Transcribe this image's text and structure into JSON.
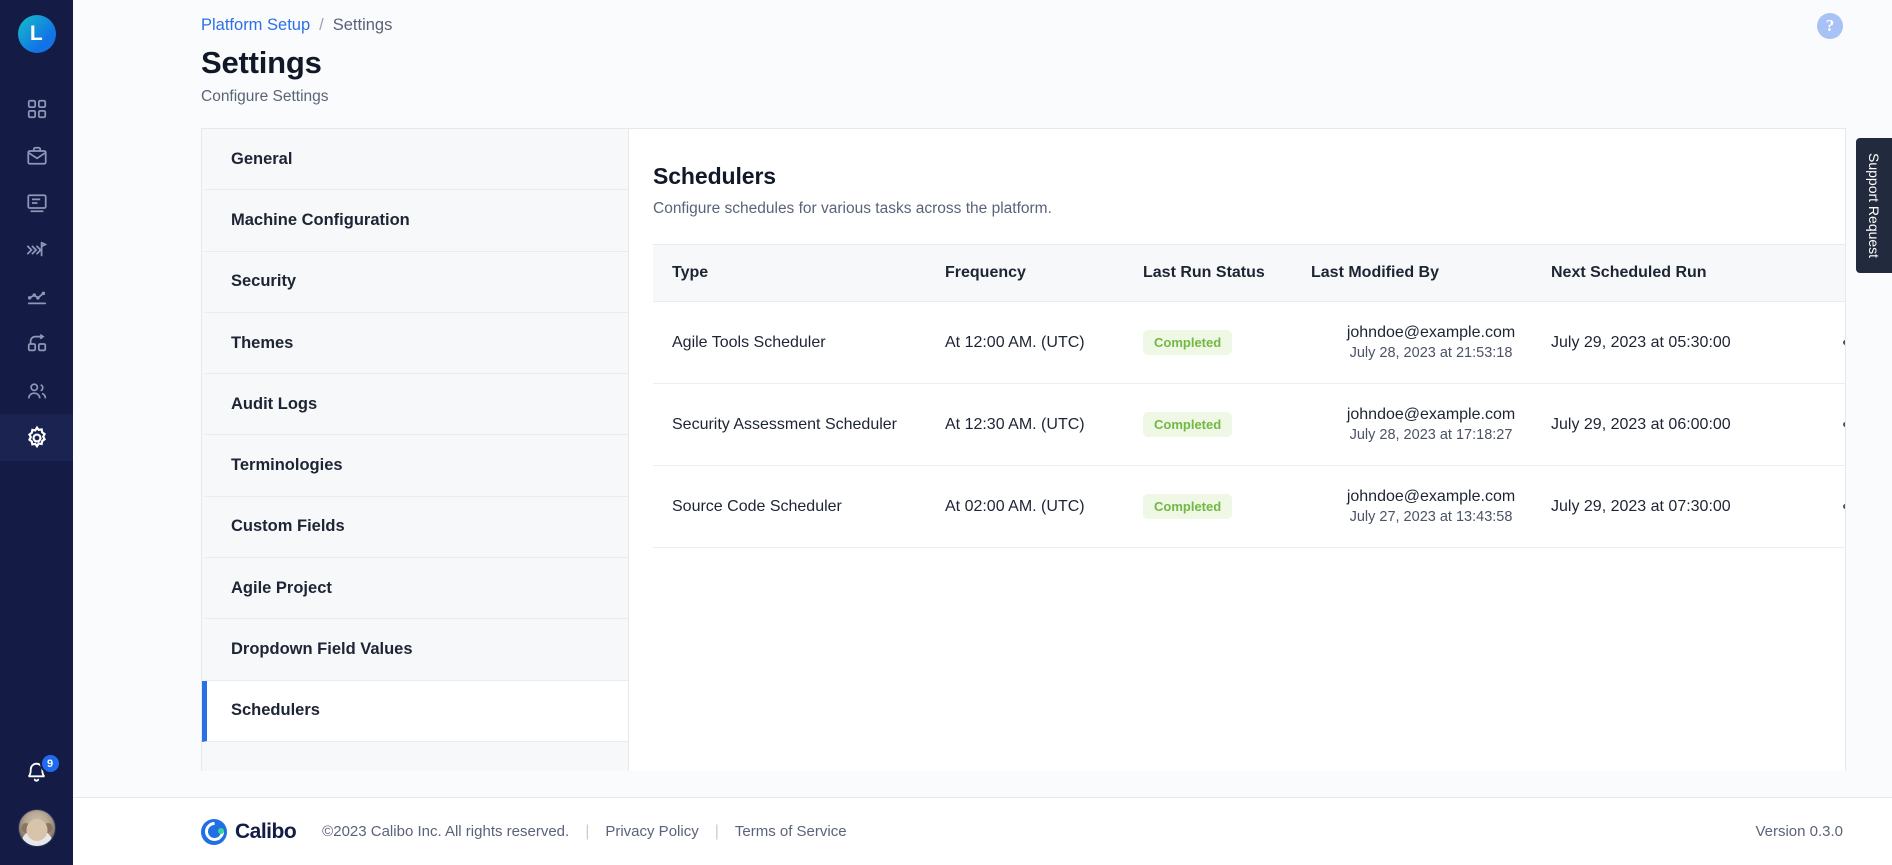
{
  "rail": {
    "logo_text": "L",
    "icons": [
      {
        "name": "dashboard-icon",
        "label": "Dashboard"
      },
      {
        "name": "briefcase-icon",
        "label": "Portfolio"
      },
      {
        "name": "board-icon",
        "label": "Boards"
      },
      {
        "name": "pipeline-icon",
        "label": "Pipelines"
      },
      {
        "name": "analytics-icon",
        "label": "Analytics"
      },
      {
        "name": "integration-icon",
        "label": "Integrations"
      },
      {
        "name": "users-icon",
        "label": "Users"
      },
      {
        "name": "gear-icon",
        "label": "Settings"
      }
    ],
    "notification_count": "9"
  },
  "header": {
    "breadcrumb_root": "Platform Setup",
    "breadcrumb_sep": "/",
    "breadcrumb_current": "Settings",
    "title": "Settings",
    "subtitle": "Configure Settings",
    "help_glyph": "?"
  },
  "settings_nav": {
    "items": [
      {
        "label": "General",
        "active": false
      },
      {
        "label": "Machine Configuration",
        "active": false
      },
      {
        "label": "Security",
        "active": false
      },
      {
        "label": "Themes",
        "active": false
      },
      {
        "label": "Audit Logs",
        "active": false
      },
      {
        "label": "Terminologies",
        "active": false
      },
      {
        "label": "Custom Fields",
        "active": false
      },
      {
        "label": "Agile Project",
        "active": false
      },
      {
        "label": "Dropdown Field Values",
        "active": false
      },
      {
        "label": "Schedulers",
        "active": true
      }
    ]
  },
  "panel": {
    "title": "Schedulers",
    "subtitle": "Configure schedules for various tasks across the platform.",
    "columns": [
      "Type",
      "Frequency",
      "Last Run Status",
      "Last Modified By",
      "Next Scheduled Run",
      ""
    ],
    "rows": [
      {
        "type": "Agile Tools Scheduler",
        "frequency": "At 12:00 AM. (UTC)",
        "status": "Completed",
        "modified_by": "johndoe@example.com",
        "modified_at": "July 28, 2023 at 21:53:18",
        "next_run": "July 29, 2023 at 05:30:00",
        "actions_label": "Row actions"
      },
      {
        "type": "Security Assessment Scheduler",
        "frequency": "At 12:30 AM. (UTC)",
        "status": "Completed",
        "modified_by": "johndoe@example.com",
        "modified_at": "July 28, 2023 at 17:18:27",
        "next_run": "July 29, 2023 at 06:00:00",
        "actions_label": "Row actions"
      },
      {
        "type": "Source Code Scheduler",
        "frequency": "At 02:00 AM. (UTC)",
        "status": "Completed",
        "modified_by": "johndoe@example.com",
        "modified_at": "July 27, 2023 at 13:43:58",
        "next_run": "July 29, 2023 at 07:30:00",
        "actions_label": "Row actions"
      }
    ]
  },
  "support_tab": {
    "label": "Support Request"
  },
  "footer": {
    "brand_name": "Calibo",
    "copyright": "©2023 Calibo Inc. All rights reserved.",
    "sep": "|",
    "privacy": "Privacy Policy",
    "terms": "Terms of Service",
    "version": "Version 0.3.0"
  },
  "colors": {
    "rail_bg": "#141c46",
    "accent": "#2b6fe8",
    "link": "#2e6fe8",
    "status_completed_text": "#72b844",
    "status_completed_bg": "#eef8e4",
    "support_tab_bg": "#222b3d",
    "badge_bg": "#1e6bf0"
  }
}
